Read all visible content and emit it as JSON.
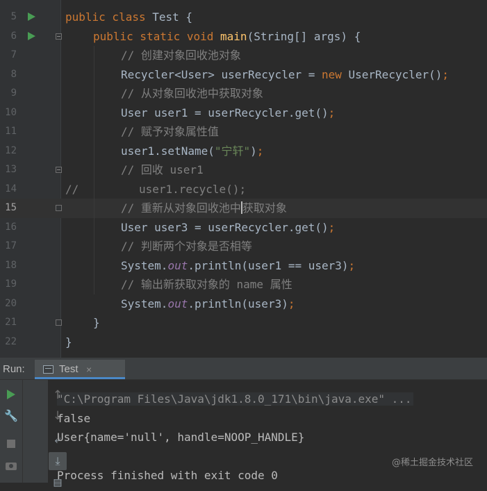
{
  "editor": {
    "current_line": 15,
    "lines": [
      {
        "num": "5",
        "run": true,
        "fold": "",
        "indent": 0,
        "tokens": [
          {
            "t": "public class ",
            "c": "kw"
          },
          {
            "t": "Test ",
            "c": "plain"
          },
          {
            "t": "{",
            "c": "plain"
          }
        ]
      },
      {
        "num": "6",
        "run": true,
        "fold": "open",
        "indent": 1,
        "tokens": [
          {
            "t": "public static void ",
            "c": "kw"
          },
          {
            "t": "main",
            "c": "fn"
          },
          {
            "t": "(String[] args) {",
            "c": "plain"
          }
        ]
      },
      {
        "num": "7",
        "run": false,
        "fold": "",
        "indent": 2,
        "tokens": [
          {
            "t": "// 创建对象回收池对象",
            "c": "cm"
          }
        ]
      },
      {
        "num": "8",
        "run": false,
        "fold": "",
        "indent": 2,
        "tokens": [
          {
            "t": "Recycler<User> userRecycler = ",
            "c": "plain"
          },
          {
            "t": "new ",
            "c": "kw"
          },
          {
            "t": "UserRecycler()",
            "c": "plain"
          },
          {
            "t": ";",
            "c": "kw"
          }
        ]
      },
      {
        "num": "9",
        "run": false,
        "fold": "",
        "indent": 2,
        "tokens": [
          {
            "t": "// 从对象回收池中获取对象",
            "c": "cm"
          }
        ]
      },
      {
        "num": "10",
        "run": false,
        "fold": "",
        "indent": 2,
        "tokens": [
          {
            "t": "User user1 = userRecycler.get()",
            "c": "plain"
          },
          {
            "t": ";",
            "c": "kw"
          }
        ]
      },
      {
        "num": "11",
        "run": false,
        "fold": "",
        "indent": 2,
        "tokens": [
          {
            "t": "// 赋予对象属性值",
            "c": "cm"
          }
        ]
      },
      {
        "num": "12",
        "run": false,
        "fold": "",
        "indent": 2,
        "tokens": [
          {
            "t": "user1.setName(",
            "c": "plain"
          },
          {
            "t": "\"宁轩\"",
            "c": "str"
          },
          {
            "t": ")",
            "c": "plain"
          },
          {
            "t": ";",
            "c": "kw"
          }
        ]
      },
      {
        "num": "13",
        "run": false,
        "fold": "open",
        "indent": 2,
        "tokens": [
          {
            "t": "// 回收 user1",
            "c": "cm"
          }
        ]
      },
      {
        "num": "14",
        "run": false,
        "fold": "",
        "indent": 0,
        "tokens": [
          {
            "t": "//         user1.recycle();",
            "c": "cm"
          }
        ]
      },
      {
        "num": "15",
        "run": false,
        "fold": "close",
        "indent": 2,
        "cursor_after": 12,
        "tokens": [
          {
            "t": "// 重新从对象回收池中获取对象",
            "c": "cm"
          }
        ]
      },
      {
        "num": "16",
        "run": false,
        "fold": "",
        "indent": 2,
        "tokens": [
          {
            "t": "User user3 = userRecycler.get()",
            "c": "plain"
          },
          {
            "t": ";",
            "c": "kw"
          }
        ]
      },
      {
        "num": "17",
        "run": false,
        "fold": "",
        "indent": 2,
        "tokens": [
          {
            "t": "// 判断两个对象是否相等",
            "c": "cm"
          }
        ]
      },
      {
        "num": "18",
        "run": false,
        "fold": "",
        "indent": 2,
        "tokens": [
          {
            "t": "System.",
            "c": "plain"
          },
          {
            "t": "out",
            "c": "fld"
          },
          {
            "t": ".println(user1 == user3)",
            "c": "plain"
          },
          {
            "t": ";",
            "c": "kw"
          }
        ]
      },
      {
        "num": "19",
        "run": false,
        "fold": "",
        "indent": 2,
        "tokens": [
          {
            "t": "// 输出新获取对象的 name 属性",
            "c": "cm"
          }
        ]
      },
      {
        "num": "20",
        "run": false,
        "fold": "",
        "indent": 2,
        "tokens": [
          {
            "t": "System.",
            "c": "plain"
          },
          {
            "t": "out",
            "c": "fld"
          },
          {
            "t": ".println(user3)",
            "c": "plain"
          },
          {
            "t": ";",
            "c": "kw"
          }
        ]
      },
      {
        "num": "21",
        "run": false,
        "fold": "close",
        "indent": 1,
        "tokens": [
          {
            "t": "}",
            "c": "plain"
          }
        ]
      },
      {
        "num": "22",
        "run": false,
        "fold": "",
        "indent": 0,
        "tokens": [
          {
            "t": "}",
            "c": "plain"
          }
        ]
      }
    ]
  },
  "run_panel": {
    "label": "Run:",
    "tab_title": "Test",
    "tab_close": "×"
  },
  "toolbar_icons": [
    "rerun-icon",
    "settings-wrench-icon",
    "stop-icon",
    "camera-icon",
    "scroll-up-icon",
    "scroll-down-icon",
    "soft-wrap-icon",
    "scroll-to-end-icon",
    "clear-icon"
  ],
  "console": {
    "lines": [
      "\"C:\\Program Files\\Java\\jdk1.8.0_171\\bin\\java.exe\" ...",
      "false",
      "User{name='null', handle=NOOP_HANDLE}",
      "",
      "Process finished with exit code 0"
    ]
  },
  "watermark": "@稀土掘金技术社区",
  "colors": {
    "background": "#2b2b2b",
    "gutter": "#313335",
    "keyword": "#cc7832",
    "function": "#ffc66d",
    "comment": "#808080",
    "string": "#6a8759",
    "field": "#9876aa",
    "text": "#a9b7c6",
    "run_green": "#499c54"
  }
}
